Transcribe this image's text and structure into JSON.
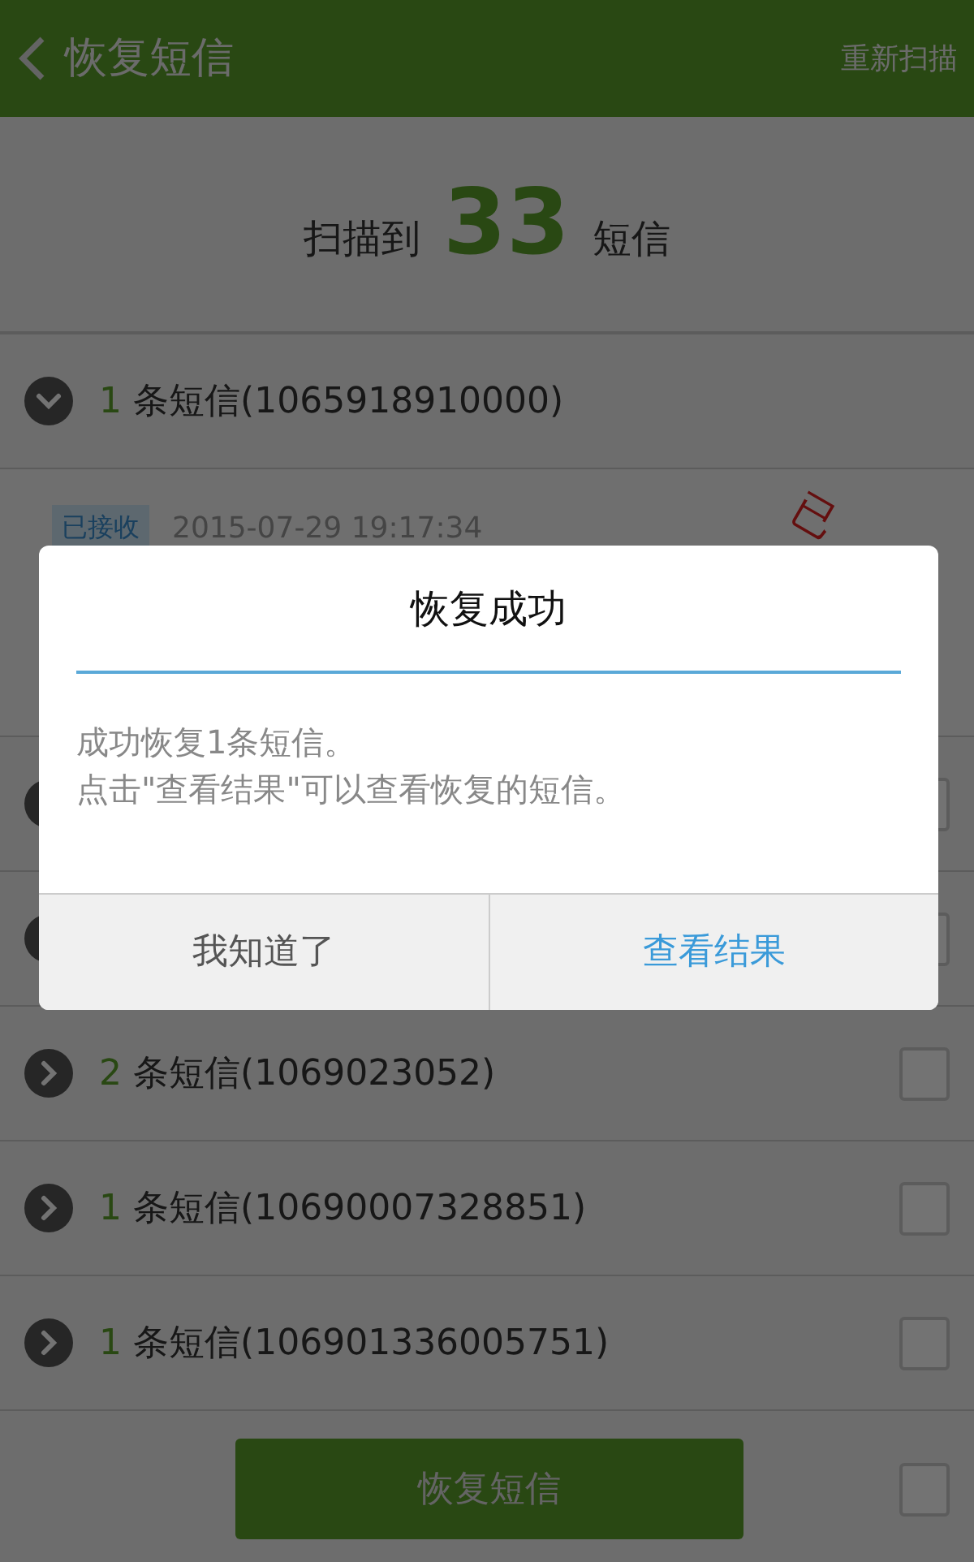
{
  "header": {
    "title": "恢复短信",
    "action": "重新扫描"
  },
  "summary": {
    "prefix": "扫描到",
    "count": "33",
    "suffix": "短信"
  },
  "expanded_group": {
    "count": "1",
    "label": "条短信(1065918910000)",
    "expanded": true,
    "message": {
      "tag": "已接收",
      "time": "2015-07-29 19:17:34",
      "stamp": "已"
    }
  },
  "groups": [
    {
      "expanded": false,
      "checked": false
    },
    {
      "expanded": false,
      "checked": false
    },
    {
      "count": "2",
      "label": "条短信(1069023052)",
      "expanded": false,
      "checked": false
    },
    {
      "count": "1",
      "label": "条短信(10690007328851)",
      "expanded": false,
      "checked": false
    },
    {
      "count": "1",
      "label": "条短信(106901336005751)",
      "expanded": false,
      "checked": false
    }
  ],
  "footer": {
    "button": "恢复短信",
    "checked": false
  },
  "dialog": {
    "title": "恢复成功",
    "lines": [
      "成功恢复1条短信。",
      "点击\"查看结果\"可以查看恢复的短信。"
    ],
    "buttons": [
      {
        "label": "我知道了",
        "kind": "neutral"
      },
      {
        "label": "查看结果",
        "kind": "primary"
      }
    ]
  }
}
